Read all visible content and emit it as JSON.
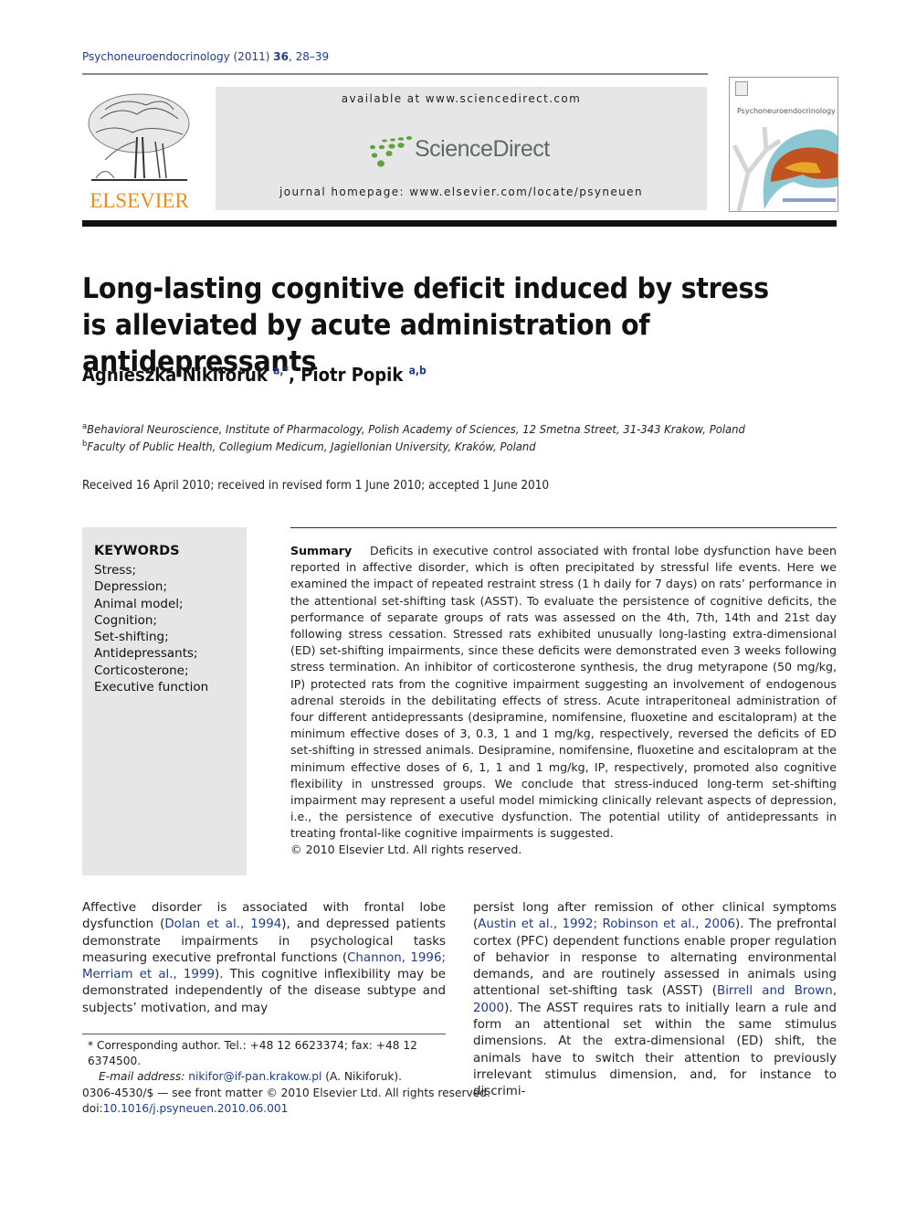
{
  "header": {
    "journal_name": "Psychoneuroendocrinology (2011)",
    "volume": "36",
    "pages": ", 28–39",
    "publisher_wordmark": "ELSEVIER",
    "available_at": "available at www.sciencedirect.com",
    "sciencedirect_logo_text": "ScienceDirect",
    "journal_homepage": "journal homepage: www.elsevier.com/locate/psyneuen",
    "cover_title": "Psychoneuroendocrinology",
    "colors": {
      "elsevier_orange": "#f08a1e",
      "sd_green": "#5aa43c",
      "link_blue": "#1d3c8c"
    }
  },
  "article": {
    "title": "Long-lasting cognitive deficit induced by stress is alleviated by acute administration of antidepressants",
    "authors": [
      {
        "name": "Agnieszka Nikiforuk",
        "affil_marks": "a,*"
      },
      {
        "name": "Piotr Popik",
        "affil_marks": "a,b"
      }
    ],
    "author_separator": ", ",
    "affiliations": [
      {
        "mark": "a",
        "text": "Behavioral Neuroscience, Institute of Pharmacology, Polish Academy of Sciences, 12 Smetna Street, 31-343 Krakow, Poland"
      },
      {
        "mark": "b",
        "text": "Faculty of Public Health, Collegium Medicum, Jagiellonian University, Kraków, Poland"
      }
    ],
    "received": "Received 16 April 2010; received in revised form 1 June 2010; accepted 1 June 2010"
  },
  "keywords": {
    "title": "KEYWORDS",
    "items": [
      "Stress;",
      "Depression;",
      "Animal model;",
      "Cognition;",
      "Set-shifting;",
      "Antidepressants;",
      "Corticosterone;",
      "Executive function"
    ]
  },
  "summary": {
    "label": "Summary",
    "text": "Deficits in executive control associated with frontal lobe dysfunction have been reported in affective disorder, which is often precipitated by stressful life events. Here we examined the impact of repeated restraint stress (1 h daily for 7 days) on rats’ performance in the attentional set-shifting task (ASST). To evaluate the persistence of cognitive deficits, the performance of separate groups of rats was assessed on the 4th, 7th, 14th and 21st day following stress cessation. Stressed rats exhibited unusually long-lasting extra-dimensional (ED) set-shifting impairments, since these deficits were demonstrated even 3 weeks following stress termination. An inhibitor of corticosterone synthesis, the drug metyrapone (50 mg/kg, IP) protected rats from the cognitive impairment suggesting an involvement of endogenous adrenal steroids in the debilitating effects of stress. Acute intraperitoneal administration of four different antidepressants (desipramine, nomifensine, fluoxetine and escitalopram) at the minimum effective doses of 3, 0.3, 1 and 1 mg/kg, respectively, reversed the deficits of ED set-shifting in stressed animals. Desipramine, nomifensine, fluoxetine and escitalopram at the minimum effective doses of 6, 1, 1 and 1 mg/kg, IP, respectively, promoted also cognitive flexibility in unstressed groups. We conclude that stress-induced long-term set-shifting impairment may represent a useful model mimicking clinically relevant aspects of depression, i.e., the persistence of executive dysfunction. The potential utility of antidepressants in treating frontal-like cognitive impairments is suggested.",
    "copyright": "© 2010 Elsevier Ltd. All rights reserved."
  },
  "body": {
    "col1": [
      {
        "t": "Affective disorder is associated with frontal lobe dysfunction ("
      },
      {
        "link": "Dolan et al., 1994"
      },
      {
        "t": "), and depressed patients demonstrate impairments in psychological tasks measuring executive prefrontal functions ("
      },
      {
        "link": "Channon, 1996; Merriam et al., 1999"
      },
      {
        "t": "). This cognitive inflexibility may be demonstrated independently of the disease subtype and subjects’ motivation, and may"
      }
    ],
    "col2": [
      {
        "t": "persist long after remission of other clinical symptoms ("
      },
      {
        "link": "Austin et al., 1992; Robinson et al., 2006"
      },
      {
        "t": "). The prefrontal cortex (PFC) dependent functions enable proper regulation of behavior in response to alternating environmental demands, and are routinely assessed in animals using attentional set-shifting task (ASST) ("
      },
      {
        "link": "Birrell and Brown, 2000"
      },
      {
        "t": "). The ASST requires rats to initially learn a rule and form an attentional set within the same stimulus dimensions. At the extra-dimensional (ED) shift, the animals have to switch their attention to previously irrelevant stimulus dimension, and, for instance to discrimi-"
      }
    ]
  },
  "footnote": {
    "mark": "*",
    "corresponding": "Corresponding author. Tel.: +48 12 6623374; fax: +48 12 6374500.",
    "email_label": "E-mail address:",
    "email": "nikifor@if-pan.krakow.pl",
    "email_suffix": " (A. Nikiforuk)."
  },
  "front_matter": {
    "issn_line": "0306-4530/$ — see front matter © 2010 Elsevier Ltd. All rights reserved.",
    "doi_label": "doi:",
    "doi": "10.1016/j.psyneuen.2010.06.001"
  }
}
